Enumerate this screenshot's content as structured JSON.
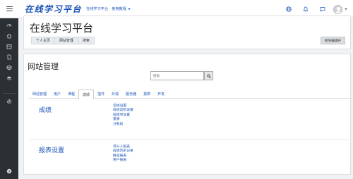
{
  "navbar": {
    "brand": "在线学习平台",
    "link": "在线学习平台",
    "dropdown": "使用教程"
  },
  "header": {
    "title": "在线学习平台",
    "breadcrumb": [
      "个人主页",
      "网站管理",
      "搜索"
    ],
    "block_button": "板块编辑开"
  },
  "admin": {
    "title": "网站管理",
    "search": {
      "placeholder": "搜索"
    },
    "tabs": [
      "网站管理",
      "用户",
      "课程",
      "成绩",
      "插件",
      "外观",
      "服务器",
      "报表",
      "开发"
    ],
    "active_tab": "成绩",
    "sections": [
      {
        "title": "成绩",
        "links": [
          "常规设置",
          "成绩类别设置",
          "成绩项设置",
          "量表",
          "分数段"
        ]
      },
      {
        "title": "报表设置",
        "links": [
          "评分人报表",
          "成绩历史记录",
          "概览报表",
          "用户报表"
        ]
      }
    ]
  },
  "colors": {
    "link": "#1a55b8",
    "sidebar": "#2b3035"
  }
}
